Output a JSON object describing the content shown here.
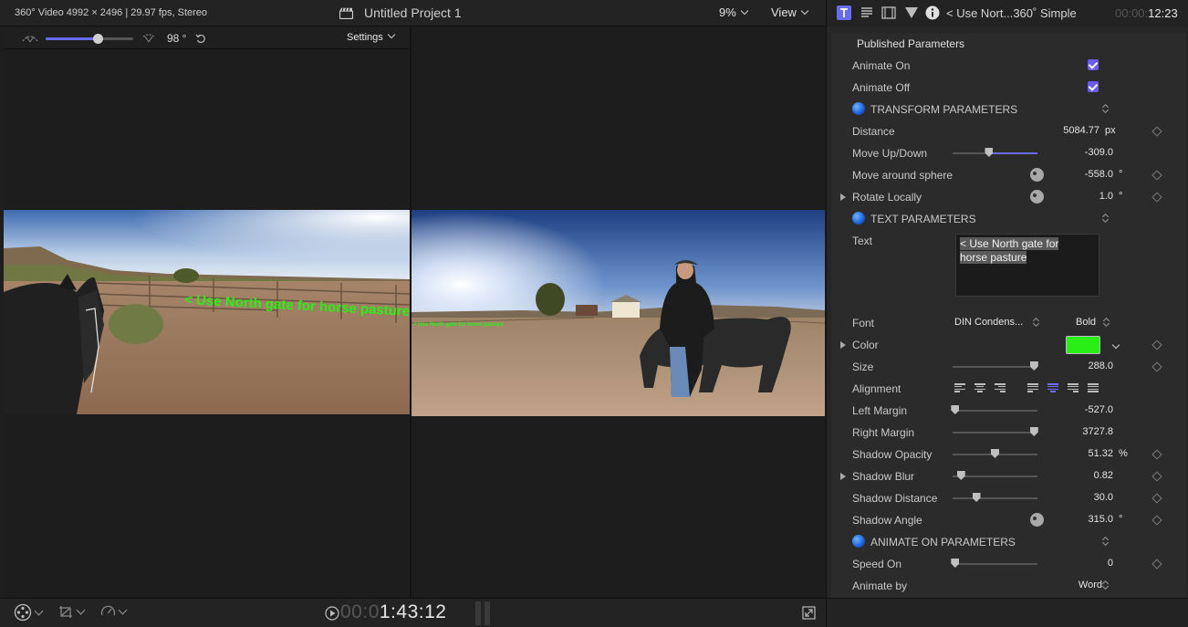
{
  "viewer": {
    "format": "360° Video 4992 × 2496 | 29.97 fps, Stereo",
    "project": "Untitled Project 1",
    "zoom": "9%",
    "view_menu": "View",
    "fov": "98 °",
    "settings_label": "Settings",
    "timecode_dim": "00:0",
    "timecode_lit": "1:43:12"
  },
  "scene": {
    "left_caption": "< Use North gate for horse pasture"
  },
  "inspector": {
    "title": "< Use Nort...360˚ Simple",
    "duration_dim": "00:00:",
    "duration_lit": "12:23",
    "published_header": "Published Parameters",
    "animate_on": "Animate On",
    "animate_off": "Animate Off",
    "transform_header": "TRANSFORM PARAMETERS",
    "distance": {
      "label": "Distance",
      "value": "5084.77",
      "unit": "px"
    },
    "move_updown": {
      "label": "Move Up/Down",
      "value": "-309.0",
      "level": 0.43
    },
    "move_sphere": {
      "label": "Move around sphere",
      "value": "-558.0",
      "unit": "°"
    },
    "rotate_locally": {
      "label": "Rotate Locally",
      "value": "1.0",
      "unit": "°"
    },
    "text_header": "TEXT PARAMETERS",
    "text": {
      "label": "Text",
      "value_line1": "< Use North gate for",
      "value_line2": "horse pasture"
    },
    "font": {
      "label": "Font",
      "family": "DIN Condens...",
      "style": "Bold"
    },
    "color": {
      "label": "Color",
      "value": "#2aef16"
    },
    "size": {
      "label": "Size",
      "value": "288.0",
      "level": 0.96
    },
    "alignment": {
      "label": "Alignment"
    },
    "left_margin": {
      "label": "Left Margin",
      "value": "-527.0",
      "level": 0.03
    },
    "right_margin": {
      "label": "Right Margin",
      "value": "3727.8",
      "level": 0.96
    },
    "shadow_opacity": {
      "label": "Shadow Opacity",
      "value": "51.32",
      "unit": "%",
      "level": 0.5
    },
    "shadow_blur": {
      "label": "Shadow Blur",
      "value": "0.82",
      "level": 0.1
    },
    "shadow_distance": {
      "label": "Shadow Distance",
      "value": "30.0",
      "level": 0.28
    },
    "shadow_angle": {
      "label": "Shadow Angle",
      "value": "315.0",
      "unit": "°"
    },
    "animate_on_header": "ANIMATE ON PARAMETERS",
    "speed_on": {
      "label": "Speed On",
      "value": "0",
      "level": 0.03
    },
    "animate_by": {
      "label": "Animate by",
      "value": "Word"
    }
  },
  "colors": {
    "accent": "#6a6cf0",
    "caption_green": "#2aef16",
    "panel": "#2b2b2b"
  }
}
